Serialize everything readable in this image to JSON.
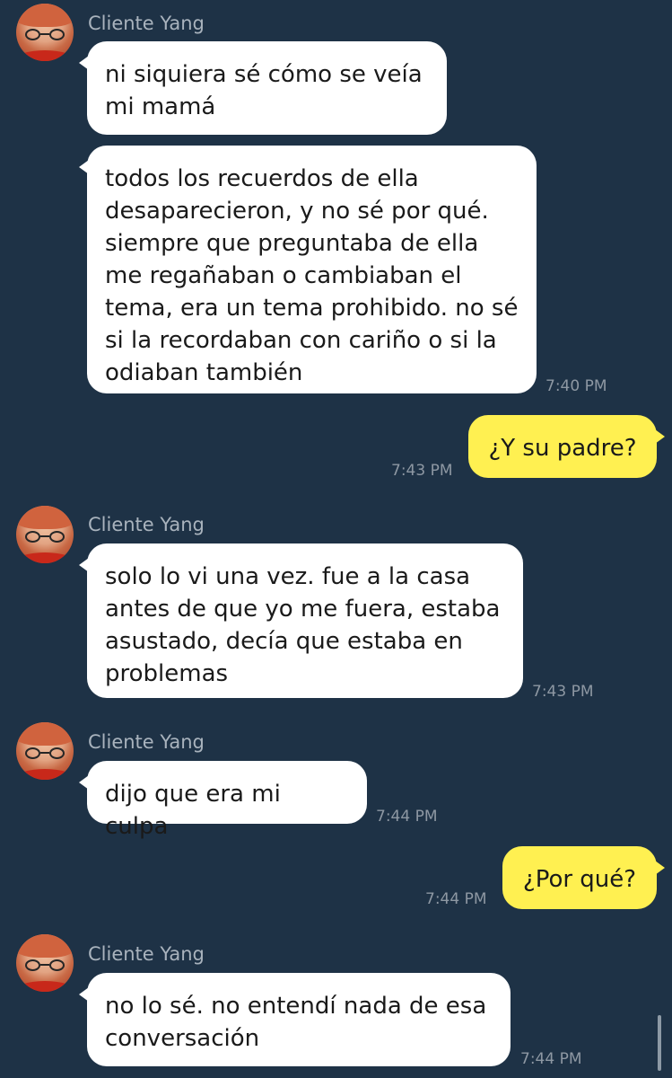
{
  "contact": {
    "name": "Cliente Yang"
  },
  "messages": [
    {
      "id": "m1",
      "side": "in",
      "text": "ni siquiera sé cómo se veía\nmi mamá",
      "time": ""
    },
    {
      "id": "m2",
      "side": "in",
      "text": "todos los recuerdos de ella\ndesaparecieron, y no sé por qué.\nsiempre que preguntaba de ella\nme regañaban o cambiaban el\ntema, era un tema prohibido. no sé\nsi la recordaban con cariño o si la\nodiaban también",
      "time": "7:40 PM"
    },
    {
      "id": "m3",
      "side": "out",
      "text": "¿Y su padre?",
      "time": "7:43 PM"
    },
    {
      "id": "m4",
      "side": "in",
      "text": "solo lo vi una vez. fue a la casa\nantes de que yo me fuera, estaba\nasustado, decía que estaba en\nproblemas",
      "time": "7:43 PM"
    },
    {
      "id": "m5",
      "side": "in",
      "text": "dijo que era mi culpa",
      "time": "7:44 PM"
    },
    {
      "id": "m6",
      "side": "out",
      "text": "¿Por qué?",
      "time": "7:44 PM"
    },
    {
      "id": "m7",
      "side": "in",
      "text": "no lo sé. no entendí nada de esa\nconversación",
      "time": "7:44 PM"
    }
  ],
  "colors": {
    "background": "#1e3246",
    "incoming_bubble": "#ffffff",
    "outgoing_bubble": "#fff051",
    "timestamp": "#8e98a3",
    "sender_name": "#a9b3bd"
  }
}
